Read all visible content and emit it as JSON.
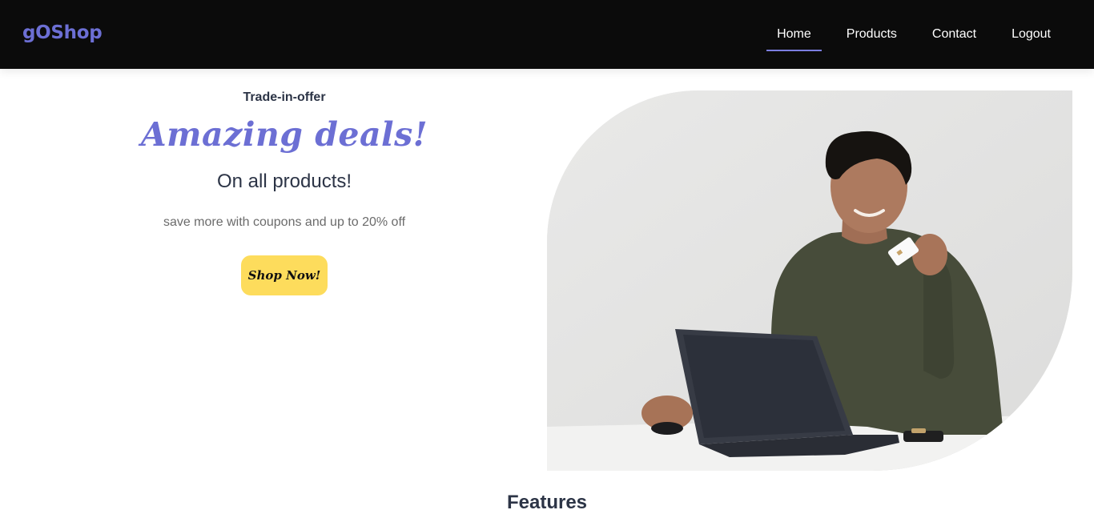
{
  "nav": {
    "logo": "gOShop",
    "links": [
      {
        "label": "Home",
        "active": true
      },
      {
        "label": "Products",
        "active": false
      },
      {
        "label": "Contact",
        "active": false
      },
      {
        "label": "Logout",
        "active": false
      }
    ]
  },
  "hero": {
    "eyebrow": "Trade-in-offer",
    "headline": "Amazing deals!",
    "subhead": "On all products!",
    "blurb": "save more with coupons and up to 20% off",
    "cta_label": "Shop Now!"
  },
  "features": {
    "title": "Features"
  },
  "colors": {
    "nav_bg": "#0b0b0b",
    "brand": "#6c6fd4",
    "cta": "#fddc5c",
    "heading": "#2c3446"
  }
}
